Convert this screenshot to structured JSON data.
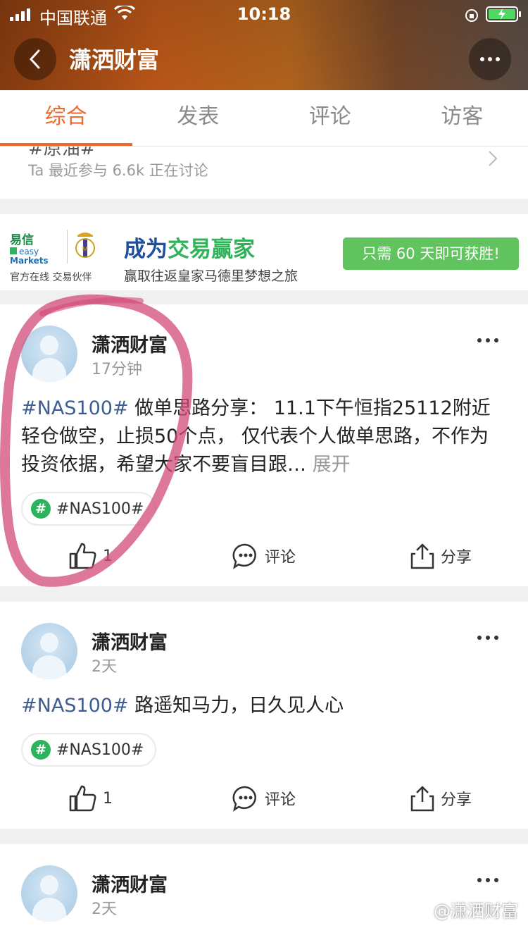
{
  "status_bar": {
    "carrier": "中国联通",
    "time": "10:18"
  },
  "header": {
    "title": "潇洒财富"
  },
  "tabs": [
    {
      "label": "综合",
      "active": true
    },
    {
      "label": "发表",
      "active": false
    },
    {
      "label": "评论",
      "active": false
    },
    {
      "label": "访客",
      "active": false
    }
  ],
  "topic": {
    "cut_text": "#原油#",
    "meta": "Ta 最近参与  6.6k 正在讨论"
  },
  "ad": {
    "brand_cn": "易信",
    "brand_en_1": "easy",
    "brand_en_2": "Markets",
    "partner_label": "官方在线 交易伙伴",
    "headline_part1": "成为",
    "headline_part2": "交易赢家",
    "subline": "赢取往返皇家马德里梦想之旅",
    "cta": "只需 60 天即可获胜!"
  },
  "posts": [
    {
      "author": "潇洒财富",
      "time": "17分钟",
      "hashtag": "#NAS100#",
      "text": " 做单思路分享： 11.1下午恒指25112附近轻仓做空，止损50个点， 仅代表个人做单思路，不作为投资依据，希望大家不要盲目跟…",
      "expand": " 展开",
      "tag": "#NAS100#",
      "likes": "1",
      "comment_label": "评论",
      "share_label": "分享"
    },
    {
      "author": "潇洒财富",
      "time": "2天",
      "hashtag": "#NAS100#",
      "text": " 路遥知马力，日久见人心",
      "tag": "#NAS100#",
      "likes": "1",
      "comment_label": "评论",
      "share_label": "分享"
    },
    {
      "author": "潇洒财富",
      "time": "2天"
    }
  ],
  "watermark": "@潇洒财富",
  "colors": {
    "accent": "#ee6a2c",
    "hashtag": "#3e5c92",
    "tag_green": "#2db35d",
    "cta_green": "#61c45f",
    "highlight": "#d24a7a"
  }
}
